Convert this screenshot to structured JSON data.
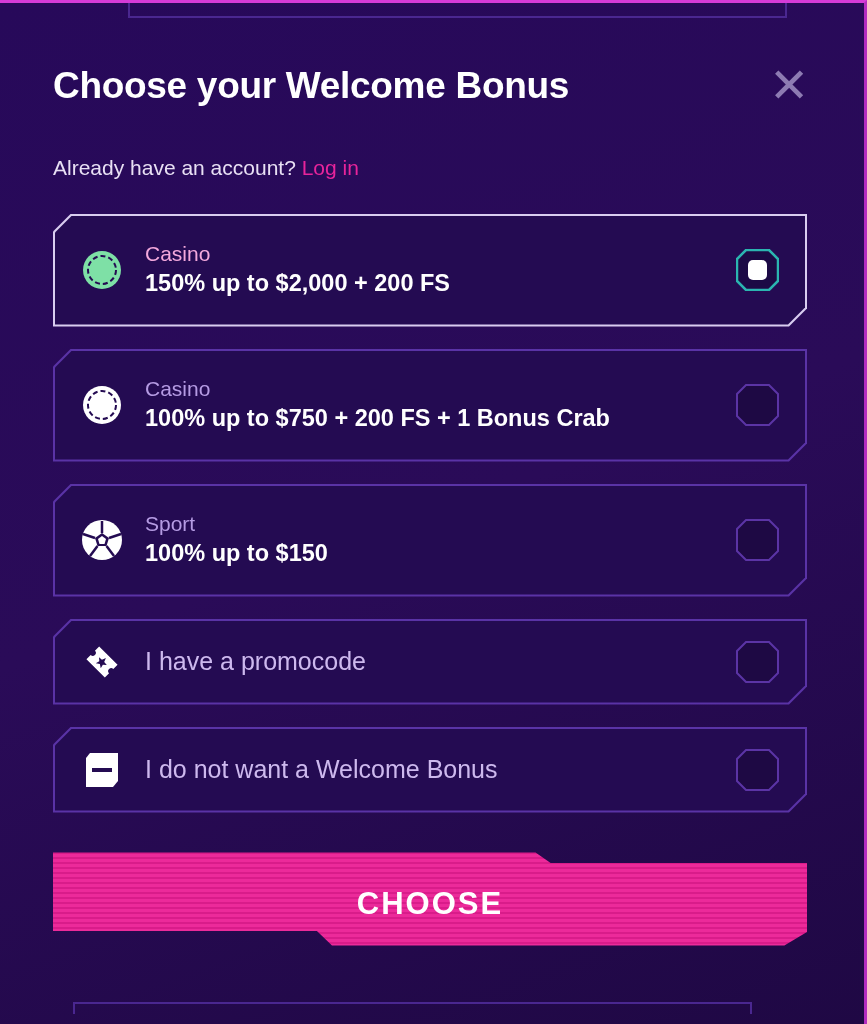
{
  "dialog": {
    "title": "Choose your Welcome Bonus",
    "close_label": "✕",
    "login_prompt": "Already have an account?",
    "login_link": "Log in"
  },
  "options": [
    {
      "kind": "casino",
      "category": "Casino",
      "offer": "150% up to $2,000 + 200 FS",
      "selected": true
    },
    {
      "kind": "casino",
      "category": "Casino",
      "offer": "100% up to $750 + 200 FS + 1 Bonus Crab",
      "selected": false
    },
    {
      "kind": "sport",
      "category": "Sport",
      "offer": "100% up to $150",
      "selected": false
    },
    {
      "kind": "promocode",
      "label": "I have a promocode",
      "selected": false
    },
    {
      "kind": "no_bonus",
      "label": "I do not want a Welcome Bonus",
      "selected": false
    }
  ],
  "button": "CHOOSE"
}
